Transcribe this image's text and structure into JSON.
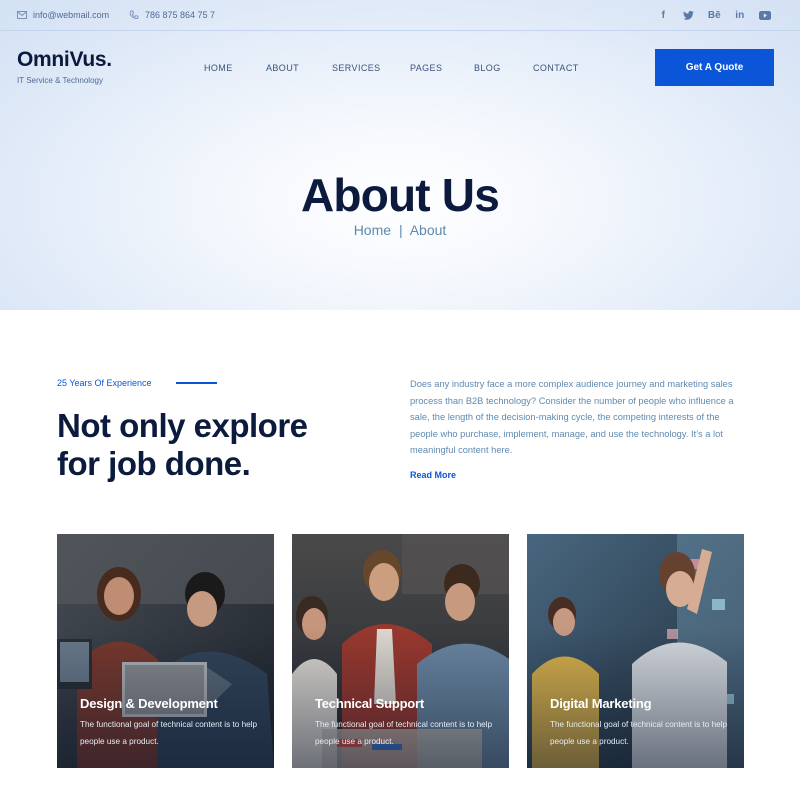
{
  "topbar": {
    "email": "info@webmail.com",
    "phone": "786 875 864 75 7",
    "social": [
      {
        "icon": "facebook-icon",
        "glyph": "f"
      },
      {
        "icon": "twitter-icon",
        "glyph": "t"
      },
      {
        "icon": "behance-icon",
        "glyph": "Bē"
      },
      {
        "icon": "linkedin-icon",
        "glyph": "in"
      },
      {
        "icon": "youtube-icon",
        "glyph": "▶"
      }
    ]
  },
  "header": {
    "logo": "OmniVus.",
    "tagline": "IT Service & Technology",
    "nav": [
      "HOME",
      "ABOUT",
      "SERVICES",
      "PAGES",
      "BLOG",
      "CONTACT"
    ],
    "cta": "Get A Quote"
  },
  "hero": {
    "title": "About Us",
    "breadcrumb": {
      "home": "Home",
      "separator": "|",
      "current": "About"
    }
  },
  "about": {
    "eyebrow": "25 Years Of Experience",
    "headline_line1": "Not only explore",
    "headline_line2": "for job done.",
    "body": "Does any industry face a more complex audience journey and marketing sales process than B2B technology? Consider the number of people who influence a sale, the length of the decision-making cycle, the competing interests of the people who purchase, implement, manage, and use the technology. It’s a lot meaningful content here.",
    "read_more": "Read More"
  },
  "cards": [
    {
      "title": "Design & Development",
      "text": "The functional goal of technical content is to help people use a product."
    },
    {
      "title": "Technical Support",
      "text": "The functional goal of technical content is to help people use a product."
    },
    {
      "title": "Digital Marketing",
      "text": "The functional goal of technical content is to help people use a product."
    }
  ],
  "colors": {
    "accent": "#0b55d9",
    "heading": "#0b1a3d",
    "muted": "#5f8ab0"
  }
}
